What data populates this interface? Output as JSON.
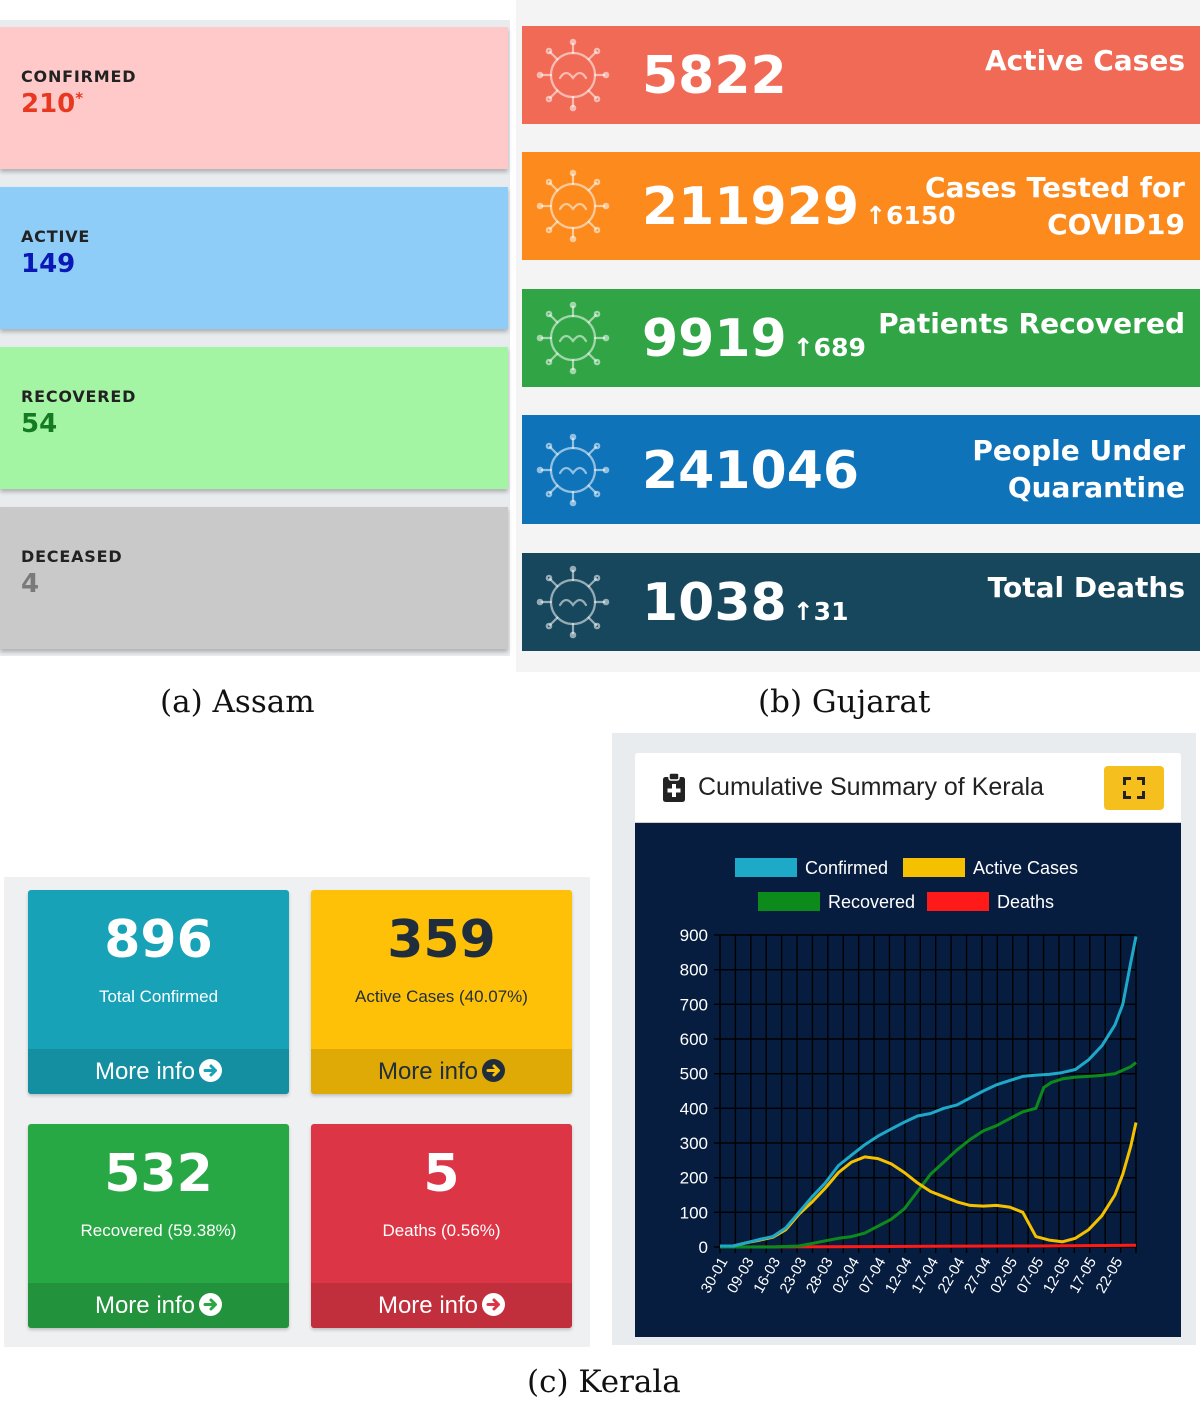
{
  "assam": {
    "caption": "(a) Assam",
    "cards": [
      {
        "label": "CONFIRMED",
        "value": "210",
        "asterisk": "*",
        "bg": "#ffc9c9",
        "color": "#e8381f"
      },
      {
        "label": "ACTIVE",
        "value": "149",
        "bg": "#8ecdf8",
        "color": "#0a18b8"
      },
      {
        "label": "RECOVERED",
        "value": "54",
        "bg": "#a3f5a3",
        "color": "#157a24"
      },
      {
        "label": "DECEASED",
        "value": "4",
        "bg": "#c9c9c9",
        "color": "#7a7a7a"
      }
    ]
  },
  "gujarat": {
    "caption": "(b) Gujarat",
    "cards": [
      {
        "value": "5822",
        "delta": "",
        "title_l1": "Active Cases",
        "title_l2": "",
        "bg": "#f16a55"
      },
      {
        "value": "211929",
        "delta": "↑6150",
        "title_l1": "Cases Tested for",
        "title_l2": "COVID19",
        "bg": "#fc8a1d"
      },
      {
        "value": "9919",
        "delta": "↑689",
        "title_l1": "Patients Recovered",
        "title_l2": "",
        "bg": "#31a546"
      },
      {
        "value": "241046",
        "delta": "",
        "title_l1": "People Under",
        "title_l2": "Quarantine",
        "bg": "#0f73ba"
      },
      {
        "value": "1038",
        "delta": "↑31",
        "title_l1": "Total Deaths",
        "title_l2": "",
        "bg": "#17475c"
      }
    ]
  },
  "kerala": {
    "caption": "(c) Kerala",
    "boxes": [
      {
        "value": "896",
        "label": "Total Confirmed",
        "more": "More info",
        "bg": "#17a2b8",
        "fg": "#ffffff"
      },
      {
        "value": "359",
        "label": "Active Cases (40.07%)",
        "more": "More info",
        "bg": "#fec107",
        "fg": "#1f2d3d"
      },
      {
        "value": "532",
        "label": "Recovered (59.38%)",
        "more": "More info",
        "bg": "#28a745",
        "fg": "#ffffff"
      },
      {
        "value": "5",
        "label": "Deaths (0.56%)",
        "more": "More info",
        "bg": "#dc3545",
        "fg": "#ffffff"
      }
    ],
    "chart_card": {
      "title": "Cumulative Summary of Kerala",
      "header_icon": "clipboard-plus-icon",
      "button_icon": "expand-icon",
      "button_color": "#f5bf1d"
    }
  },
  "chart_data": {
    "type": "line",
    "title": "",
    "xlabel": "",
    "ylabel": "",
    "ylim": [
      0,
      900
    ],
    "yticks": [
      0,
      100,
      200,
      300,
      400,
      500,
      600,
      700,
      800,
      900
    ],
    "x_ticks": [
      "30-01",
      "09-03",
      "16-03",
      "23-03",
      "28-03",
      "02-04",
      "07-04",
      "12-04",
      "17-04",
      "22-04",
      "27-04",
      "02-05",
      "07-05",
      "12-05",
      "17-05",
      "22-05"
    ],
    "x_start": 0,
    "x_end": 15.8,
    "grid": true,
    "legend_position": "top",
    "background": "#071d3f",
    "series": [
      {
        "name": "Confirmed",
        "color": "#1fa9c9",
        "x": [
          0,
          0.5,
          1,
          1.5,
          2,
          2.5,
          3,
          3.5,
          4,
          4.5,
          5,
          5.5,
          6,
          6.5,
          7,
          7.5,
          8,
          8.5,
          9,
          9.5,
          10,
          10.5,
          11,
          11.5,
          12,
          12.5,
          13,
          13.5,
          14,
          14.5,
          15,
          15.3,
          15.6,
          15.8
        ],
        "y": [
          3,
          3,
          12,
          22,
          30,
          55,
          100,
          145,
          185,
          235,
          265,
          295,
          320,
          340,
          360,
          378,
          385,
          400,
          410,
          430,
          450,
          468,
          480,
          492,
          496,
          498,
          503,
          512,
          540,
          580,
          640,
          700,
          820,
          896
        ]
      },
      {
        "name": "Active Cases",
        "color": "#f5c000",
        "x": [
          0,
          0.5,
          1,
          1.5,
          2,
          2.5,
          3,
          3.5,
          4,
          4.5,
          5,
          5.5,
          6,
          6.5,
          7,
          7.5,
          8,
          8.5,
          9,
          9.5,
          10,
          10.5,
          11,
          11.5,
          12,
          12.5,
          13,
          13.5,
          14,
          14.5,
          15,
          15.3,
          15.6,
          15.8
        ],
        "y": [
          3,
          3,
          12,
          20,
          28,
          50,
          95,
          130,
          170,
          215,
          245,
          260,
          255,
          240,
          215,
          185,
          160,
          145,
          130,
          120,
          118,
          120,
          115,
          100,
          30,
          20,
          15,
          25,
          50,
          90,
          150,
          210,
          290,
          359
        ]
      },
      {
        "name": "Recovered",
        "color": "#0d8a1c",
        "x": [
          0,
          1,
          2,
          3,
          3.5,
          4,
          4.5,
          5,
          5.5,
          6,
          6.5,
          7,
          7.5,
          8,
          8.5,
          9,
          9.5,
          10,
          10.5,
          11,
          11.5,
          12,
          12.3,
          12.6,
          13,
          13.5,
          14,
          14.5,
          15,
          15.3,
          15.6,
          15.8
        ],
        "y": [
          0,
          0,
          0,
          3,
          10,
          18,
          25,
          30,
          40,
          60,
          80,
          110,
          160,
          210,
          245,
          280,
          310,
          335,
          350,
          370,
          390,
          400,
          460,
          475,
          485,
          490,
          492,
          495,
          500,
          510,
          520,
          532
        ]
      },
      {
        "name": "Deaths",
        "color": "#ff1a1a",
        "x": [
          0,
          4,
          8,
          12,
          15.8
        ],
        "y": [
          0,
          1,
          2,
          3,
          5
        ]
      }
    ]
  }
}
